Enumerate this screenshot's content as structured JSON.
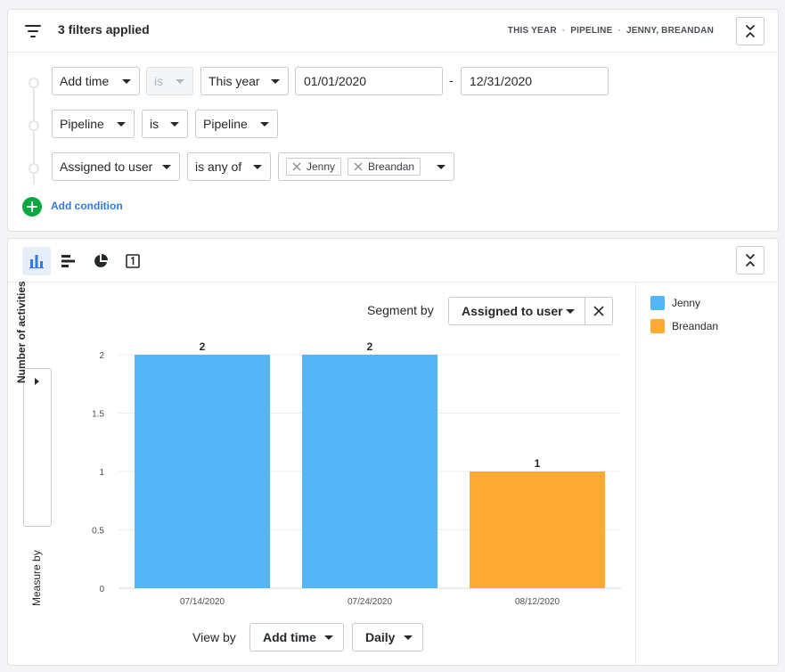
{
  "header": {
    "title": "3 filters applied",
    "summary": [
      "THIS YEAR",
      "PIPELINE",
      "JENNY, BREANDAN"
    ],
    "separator": "·"
  },
  "filters": [
    {
      "field": "Add time",
      "operator": "is",
      "operator_disabled": true,
      "value": "This year",
      "date_from": "01/01/2020",
      "date_to": "12/31/2020",
      "range_separator": "-"
    },
    {
      "field": "Pipeline",
      "operator": "is",
      "value": "Pipeline"
    },
    {
      "field": "Assigned to user",
      "operator": "is any of",
      "chips": [
        "Jenny",
        "Breandan"
      ]
    }
  ],
  "add_condition_label": "Add condition",
  "toolbar": {
    "chart_types": [
      "vertical-bar-chart-icon",
      "horizontal-bar-chart-icon",
      "pie-chart-icon",
      "single-number-icon"
    ],
    "active": "vertical-bar-chart-icon"
  },
  "segment": {
    "label": "Segment by",
    "value": "Assigned to user"
  },
  "measure": {
    "label": "Measure by",
    "value": "Number of activities"
  },
  "view": {
    "label": "View by",
    "field": "Add time",
    "interval": "Daily"
  },
  "legend": [
    {
      "name": "Jenny",
      "color": "#54b5f7"
    },
    {
      "name": "Breandan",
      "color": "#ffaa33"
    }
  ],
  "chart_data": {
    "type": "bar",
    "categories": [
      "07/14/2020",
      "07/24/2020",
      "08/12/2020"
    ],
    "values": [
      2,
      2,
      1
    ],
    "bar_series": [
      "Jenny",
      "Jenny",
      "Breandan"
    ],
    "data_labels": [
      "2",
      "2",
      "1"
    ],
    "yticks": [
      "0",
      "0.5",
      "1",
      "1.5",
      "2"
    ],
    "ylim": [
      0,
      2
    ],
    "grid": true,
    "legend_position": "right",
    "colors": {
      "Jenny": "#54b5f7",
      "Breandan": "#ffaa33"
    }
  }
}
